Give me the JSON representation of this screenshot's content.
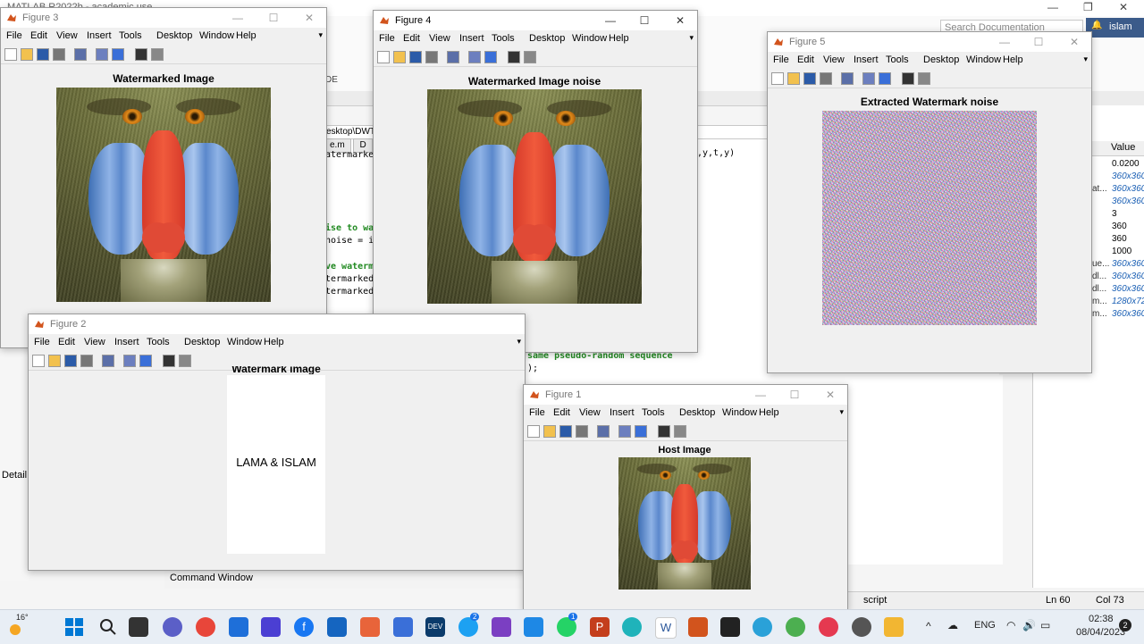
{
  "matlab": {
    "title": "MATLAB R2022b - academic use",
    "search_placeholder": "Search Documentation",
    "user": "islam",
    "path": "esktop\\DWT",
    "editor_tabs": [
      "e.m",
      "D"
    ],
    "code_lines": [
      {
        "text": "atermarke",
        "green": false
      },
      {
        "text": "ise to wa",
        "green": true
      },
      {
        "text": "noise = i",
        "green": false
      },
      {
        "text": "ve waterm",
        "green": true
      },
      {
        "text": "termarked",
        "green": false
      },
      {
        "text": "termarked",
        "green": false
      }
    ],
    "code_right": ",y,t,y)",
    "code_lower1": "same pseudo-random sequence",
    "code_lower2": ");",
    "ide_label": "DE",
    "command_window": "Command Window",
    "detail_label": "Detail",
    "status_mode": "script",
    "status_ln": "Ln  60",
    "status_col": "Col  73",
    "workspace_header": "Value",
    "workspace": [
      {
        "name": "",
        "value": "0.0200",
        "italic": false
      },
      {
        "name": "",
        "value": "360x360",
        "italic": true
      },
      {
        "name": "at...",
        "value": "360x360",
        "italic": true
      },
      {
        "name": "",
        "value": "360x360",
        "italic": true
      },
      {
        "name": "",
        "value": "3",
        "italic": false
      },
      {
        "name": "",
        "value": "360",
        "italic": false
      },
      {
        "name": "",
        "value": "360",
        "italic": false
      },
      {
        "name": "",
        "value": "1000",
        "italic": false
      },
      {
        "name": "ue...",
        "value": "360x360",
        "italic": true
      },
      {
        "name": "dl...",
        "value": "360x360",
        "italic": true
      },
      {
        "name": "dl...",
        "value": "360x360",
        "italic": true
      },
      {
        "name": "m...",
        "value": "1280x72",
        "italic": true
      },
      {
        "name": "m...",
        "value": "360x360",
        "italic": true
      }
    ]
  },
  "menu": [
    "File",
    "Edit",
    "View",
    "Insert",
    "Tools",
    "Desktop",
    "Window",
    "Help"
  ],
  "figures": {
    "fig3": {
      "title": "Figure 3",
      "axes_title": "Watermarked Image"
    },
    "fig4": {
      "title": "Figure 4",
      "axes_title": "Watermarked Image noise"
    },
    "fig5": {
      "title": "Figure 5",
      "axes_title": "Extracted Watermark noise"
    },
    "fig2": {
      "title": "Figure 2",
      "axes_title": "Watermark image",
      "watermark_text": "LAMA & ISLAM"
    },
    "fig1": {
      "title": "Figure 1",
      "axes_title": "Host Image"
    }
  },
  "taskbar": {
    "temperature": "16°",
    "lang": "ENG",
    "time": "02:38",
    "date": "08/04/2023",
    "notifications": "2",
    "badge_twitter": "2",
    "badge_whatsapp": "1"
  }
}
